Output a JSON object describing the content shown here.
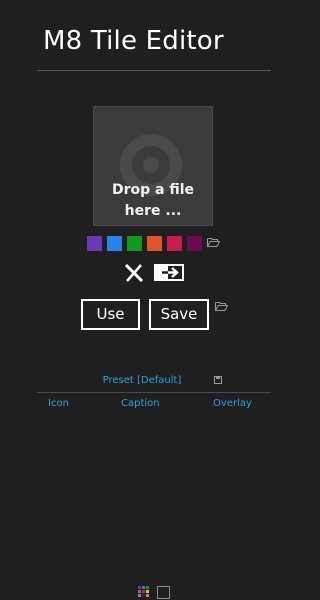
{
  "app": {
    "title": "M8 Tile Editor"
  },
  "tile": {
    "drop_text_line1": "Drop a file",
    "drop_text_line2": "here ...",
    "background": "#3b3b3b"
  },
  "swatches": [
    {
      "name": "purple",
      "color": "#6a3ab5"
    },
    {
      "name": "blue",
      "color": "#2a83e8"
    },
    {
      "name": "green",
      "color": "#109a1e"
    },
    {
      "name": "orange",
      "color": "#e0542a"
    },
    {
      "name": "crimson",
      "color": "#c81c4c"
    },
    {
      "name": "plum",
      "color": "#6a0d4e"
    }
  ],
  "icons": {
    "swatch_folder": "folder-open-icon",
    "clear": "clear-x-icon",
    "export": "export-arrow-icon",
    "save_folder": "folder-open-icon",
    "preset_save": "floppy-disk-icon",
    "grid": "tile-grid-icon",
    "square": "square-outline-icon"
  },
  "buttons": {
    "use_label": "Use",
    "save_label": "Save"
  },
  "preset": {
    "label": "Preset [Default]"
  },
  "tabs": [
    {
      "label": "Icon"
    },
    {
      "label": "Caption"
    },
    {
      "label": "Overlay"
    }
  ],
  "colors": {
    "accent": "#2aa6e0",
    "background": "#1f1f1f"
  }
}
